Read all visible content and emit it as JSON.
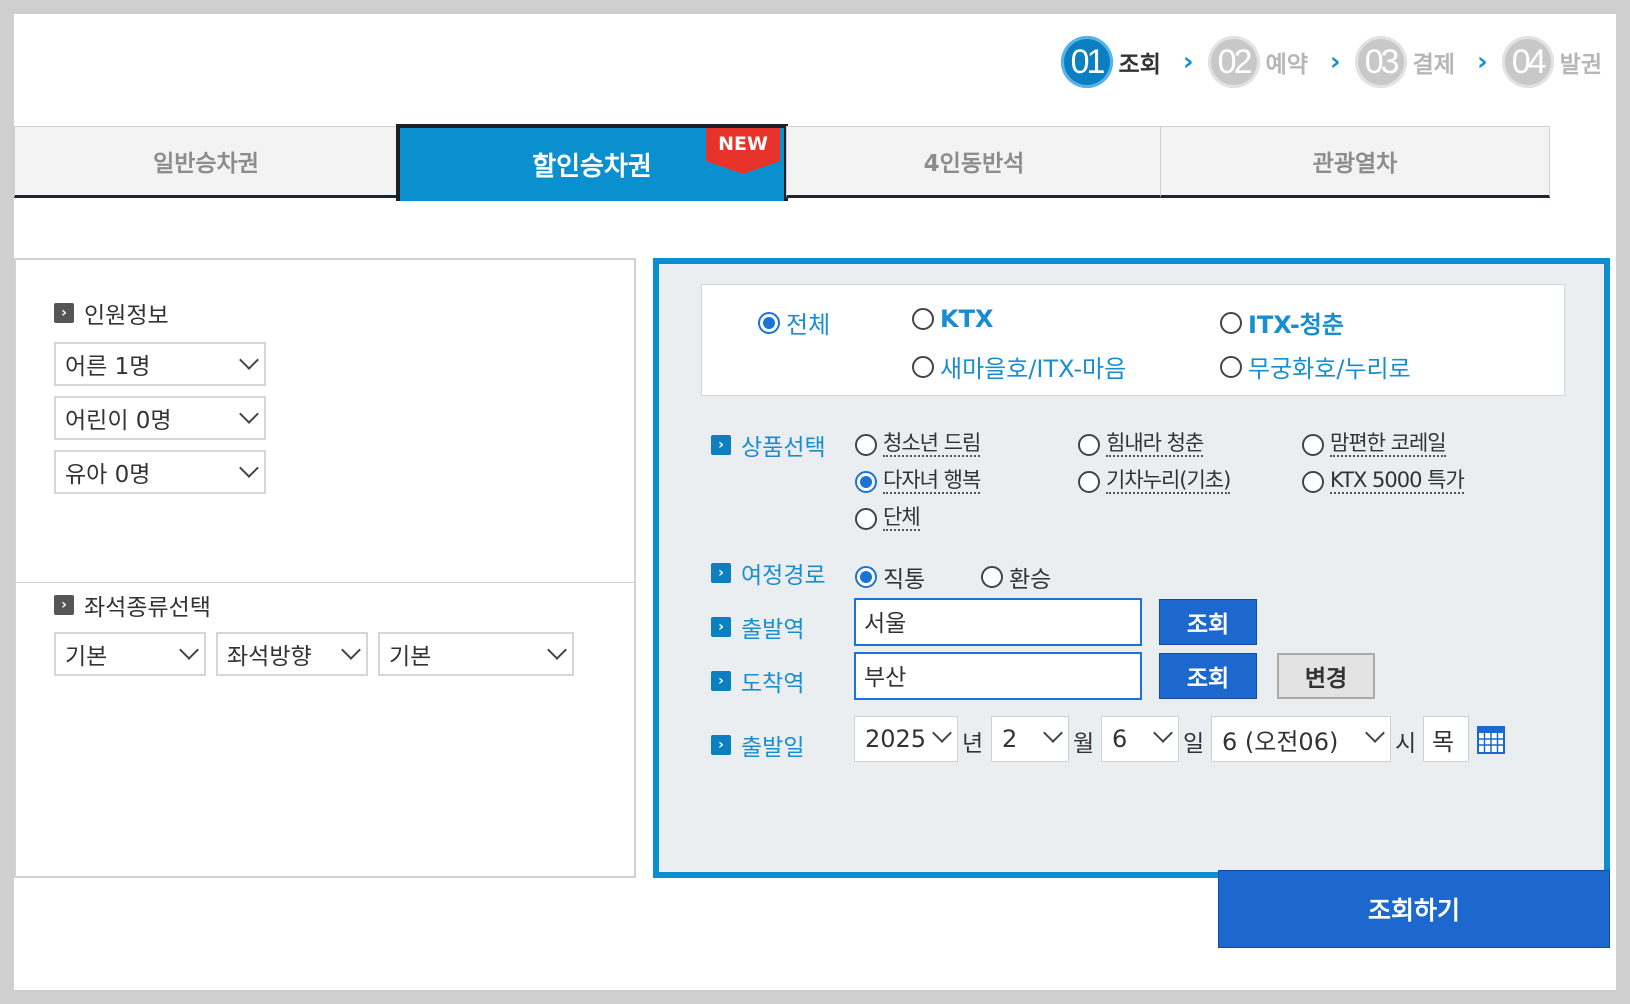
{
  "steps": [
    {
      "num": "01",
      "label": "조회",
      "active": true
    },
    {
      "num": "02",
      "label": "예약",
      "active": false
    },
    {
      "num": "03",
      "label": "결제",
      "active": false
    },
    {
      "num": "04",
      "label": "발권",
      "active": false
    }
  ],
  "tabs": [
    {
      "label": "일반승차권"
    },
    {
      "label": "할인승차권",
      "badge": "NEW"
    },
    {
      "label": "4인동반석"
    },
    {
      "label": "관광열차"
    }
  ],
  "passengers": {
    "title": "인원정보",
    "adult": "어른 1명",
    "child": "어린이 0명",
    "infant": "유아 0명"
  },
  "seat": {
    "title": "좌석종류선택",
    "type": "기본",
    "direction": "좌석방향",
    "option": "기본"
  },
  "train_types": {
    "all": "전체",
    "ktx": "KTX",
    "itx_chungchun": "ITX-청춘",
    "saemaeul": "새마을호/ITX-마음",
    "mugunghwa": "무궁화호/누리로"
  },
  "product": {
    "label": "상품선택",
    "options": [
      "청소년 드림",
      "힘내라 청춘",
      "맘편한 코레일",
      "다자녀 행복",
      "기차누리(기초)",
      "KTX 5000 특가",
      "단체"
    ]
  },
  "route": {
    "label": "여정경로",
    "direct": "직통",
    "transfer": "환승"
  },
  "departure": {
    "label": "출발역",
    "value": "서울",
    "button": "조회"
  },
  "arrival": {
    "label": "도착역",
    "value": "부산",
    "button": "조회",
    "change": "변경"
  },
  "date": {
    "label": "출발일",
    "year": "2025",
    "year_unit": "년",
    "month": "2",
    "month_unit": "월",
    "day": "6",
    "day_unit": "일",
    "hour": "6 (오전06)",
    "hour_unit": "시",
    "weekday": "목"
  },
  "submit": "조회하기",
  "colors": {
    "accent": "#0b8fd0",
    "button": "#1c68cf",
    "badge": "#e8332b"
  }
}
